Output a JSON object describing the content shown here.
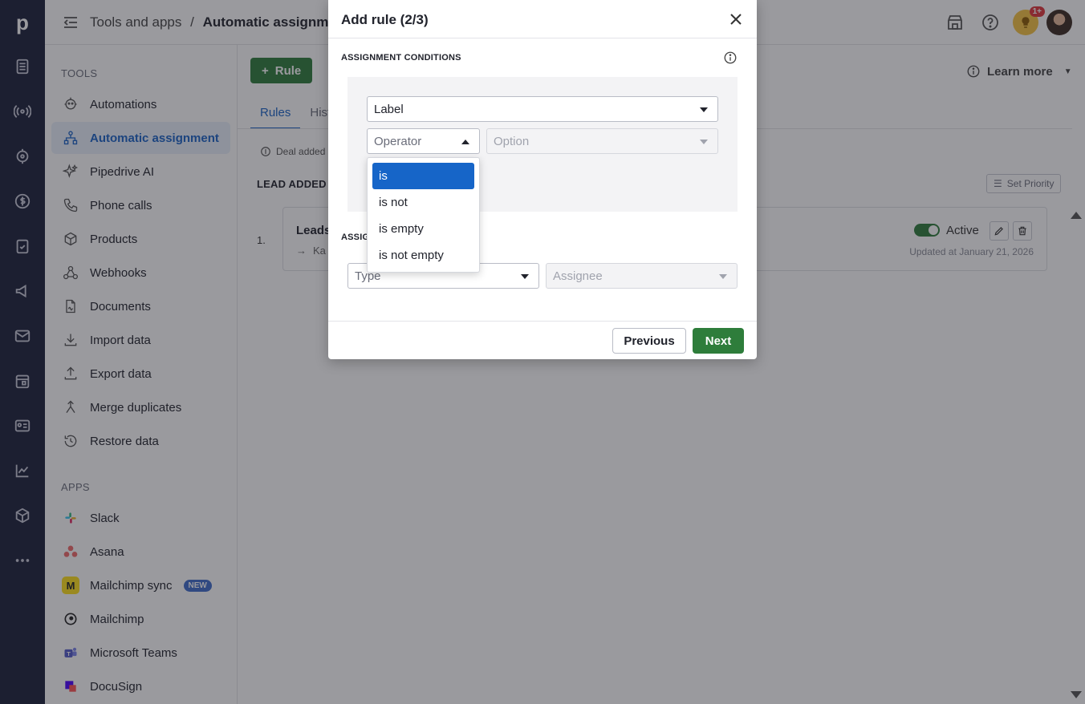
{
  "topbar": {
    "breadcrumb_parent": "Tools and apps",
    "breadcrumb_sep": "/",
    "breadcrumb_current": "Automatic assignment",
    "notification_count": "1+"
  },
  "rail": {
    "logo": "p",
    "icons": [
      "leads-icon",
      "deals-icon",
      "projects-icon",
      "money-icon",
      "activities-icon",
      "campaigns-icon",
      "mail-icon",
      "calendar-icon",
      "contacts-icon",
      "insights-icon",
      "products-icon",
      "more-icon"
    ]
  },
  "sidebar": {
    "tools_heading": "TOOLS",
    "apps_heading": "APPS",
    "tools": [
      {
        "label": "Automations",
        "icon": "robot-icon"
      },
      {
        "label": "Automatic assignment",
        "icon": "assignment-icon",
        "active": true
      },
      {
        "label": "Pipedrive AI",
        "icon": "sparkle-icon"
      },
      {
        "label": "Phone calls",
        "icon": "phone-icon"
      },
      {
        "label": "Products",
        "icon": "box-icon"
      },
      {
        "label": "Webhooks",
        "icon": "webhook-icon"
      },
      {
        "label": "Documents",
        "icon": "document-icon"
      },
      {
        "label": "Import data",
        "icon": "download-icon"
      },
      {
        "label": "Export data",
        "icon": "upload-icon"
      },
      {
        "label": "Merge duplicates",
        "icon": "merge-icon"
      },
      {
        "label": "Restore data",
        "icon": "restore-icon"
      }
    ],
    "apps": [
      {
        "label": "Slack",
        "icon": "slack-icon",
        "color": "#e01e5a"
      },
      {
        "label": "Asana",
        "icon": "asana-icon",
        "color": "#f06a6a"
      },
      {
        "label": "Mailchimp sync",
        "icon": "mailchimp-icon",
        "color": "#ffe01b",
        "badge": "NEW"
      },
      {
        "label": "Mailchimp",
        "icon": "mailchimp-icon",
        "color": "#ffffff"
      },
      {
        "label": "Microsoft Teams",
        "icon": "teams-icon",
        "color": "#5059c9"
      },
      {
        "label": "DocuSign",
        "icon": "docusign-icon",
        "color": "#4c00ff"
      }
    ]
  },
  "main": {
    "add_rule_label": "Rule",
    "tabs": [
      "Rules",
      "Hist"
    ],
    "learn_more": "Learn more",
    "deal_added": "Deal added",
    "lead_added_heading": "LEAD ADDED",
    "set_priority": "Set Priority",
    "rule_number": "1.",
    "rule_title": "Leads",
    "rule_sub": "Ka",
    "status_label": "Active",
    "updated": "Updated at January 21, 2026"
  },
  "modal": {
    "title": "Add rule (2/3)",
    "conditions_heading": "ASSIGNMENT CONDITIONS",
    "field_value": "Label",
    "operator_placeholder": "Operator",
    "option_placeholder": "Option",
    "assignee_heading": "ASSIG",
    "type_placeholder": "Type",
    "assignee_placeholder": "Assignee",
    "previous_label": "Previous",
    "next_label": "Next",
    "operator_options": [
      "is",
      "is not",
      "is empty",
      "is not empty"
    ],
    "selected_option": "is"
  },
  "colors": {
    "rail": "#1b1f3a",
    "primary_green": "#2e7d3b",
    "selected_blue": "#1665c8",
    "active_nav": "#1a63c6"
  }
}
